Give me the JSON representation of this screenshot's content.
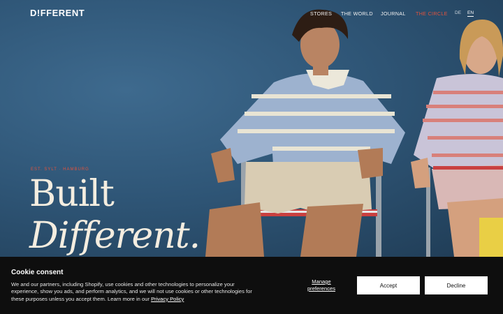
{
  "brand": {
    "logo_text": "D!FFERENT"
  },
  "nav": {
    "links": [
      {
        "label": "STORES"
      },
      {
        "label": "THE WORLD"
      },
      {
        "label": "JOURNAL"
      },
      {
        "label": "THE CIRCLE",
        "accent": "#e0533d"
      }
    ],
    "languages": [
      {
        "label": "DE",
        "active": false
      },
      {
        "label": "EN",
        "active": true
      }
    ]
  },
  "hero": {
    "eyebrow": "EST. SYLT · HAMBURG",
    "headline_line1": "Built",
    "headline_line2": "Different."
  },
  "cookie": {
    "title": "Cookie consent",
    "body": "We and our partners, including Shopify, use cookies and other technologies to personalize your experience, show you ads, and perform analytics, and we will not use cookies or other technologies for these purposes unless you accept them. Learn more in our ",
    "policy_link": "Privacy Policy",
    "manage_label": "Manage preferences",
    "accept_label": "Accept",
    "decline_label": "Decline"
  },
  "colors": {
    "accent": "#e0533d",
    "banner_bg": "#0e0e0e",
    "hero_bg": "#2f5677"
  }
}
